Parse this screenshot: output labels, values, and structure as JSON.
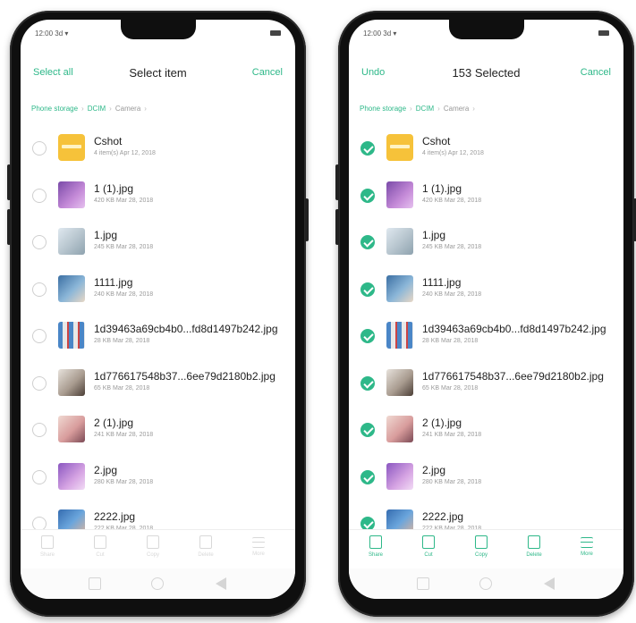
{
  "colors": {
    "accent": "#2eb889",
    "folder": "#f6c23a"
  },
  "left_screen": {
    "status_time": "12:00 3d ▾",
    "left_action": "Select all",
    "title": "Select item",
    "right_action": "Cancel",
    "breadcrumb": [
      "Phone storage",
      "DCIM",
      "Camera"
    ],
    "files": [
      {
        "name": "Cshot",
        "meta": "4 item(s)  Apr 12, 2018",
        "checked": false
      },
      {
        "name": "1 (1).jpg",
        "meta": "420 KB  Mar 28, 2018",
        "checked": false
      },
      {
        "name": "1.jpg",
        "meta": "245 KB  Mar 28, 2018",
        "checked": false
      },
      {
        "name": "1111.jpg",
        "meta": "240 KB  Mar 28, 2018",
        "checked": false
      },
      {
        "name": "1d39463a69cb4b0...fd8d1497b242.jpg",
        "meta": "28 KB  Mar 28, 2018",
        "checked": false
      },
      {
        "name": "1d776617548b37...6ee79d2180b2.jpg",
        "meta": "65 KB  Mar 28, 2018",
        "checked": false
      },
      {
        "name": "2 (1).jpg",
        "meta": "241 KB  Mar 28, 2018",
        "checked": false
      },
      {
        "name": "2.jpg",
        "meta": "280 KB  Mar 28, 2018",
        "checked": false
      },
      {
        "name": "2222.jpg",
        "meta": "222 KB  Mar 28, 2018",
        "checked": false
      }
    ],
    "toolbar": [
      "Share",
      "Cut",
      "Copy",
      "Delete",
      "More"
    ]
  },
  "right_screen": {
    "status_time": "12:00 3d ▾",
    "left_action": "Undo",
    "title": "153 Selected",
    "right_action": "Cancel",
    "breadcrumb": [
      "Phone storage",
      "DCIM",
      "Camera"
    ],
    "files": [
      {
        "name": "Cshot",
        "meta": "4 item(s)  Apr 12, 2018",
        "checked": true
      },
      {
        "name": "1 (1).jpg",
        "meta": "420 KB  Mar 28, 2018",
        "checked": true
      },
      {
        "name": "1.jpg",
        "meta": "245 KB  Mar 28, 2018",
        "checked": true
      },
      {
        "name": "1111.jpg",
        "meta": "240 KB  Mar 28, 2018",
        "checked": true
      },
      {
        "name": "1d39463a69cb4b0...fd8d1497b242.jpg",
        "meta": "28 KB  Mar 28, 2018",
        "checked": true
      },
      {
        "name": "1d776617548b37...6ee79d2180b2.jpg",
        "meta": "65 KB  Mar 28, 2018",
        "checked": true
      },
      {
        "name": "2 (1).jpg",
        "meta": "241 KB  Mar 28, 2018",
        "checked": true
      },
      {
        "name": "2.jpg",
        "meta": "280 KB  Mar 28, 2018",
        "checked": true
      },
      {
        "name": "2222.jpg",
        "meta": "222 KB  Mar 28, 2018",
        "checked": true
      }
    ],
    "toolbar": [
      "Share",
      "Cut",
      "Copy",
      "Delete",
      "More"
    ]
  }
}
